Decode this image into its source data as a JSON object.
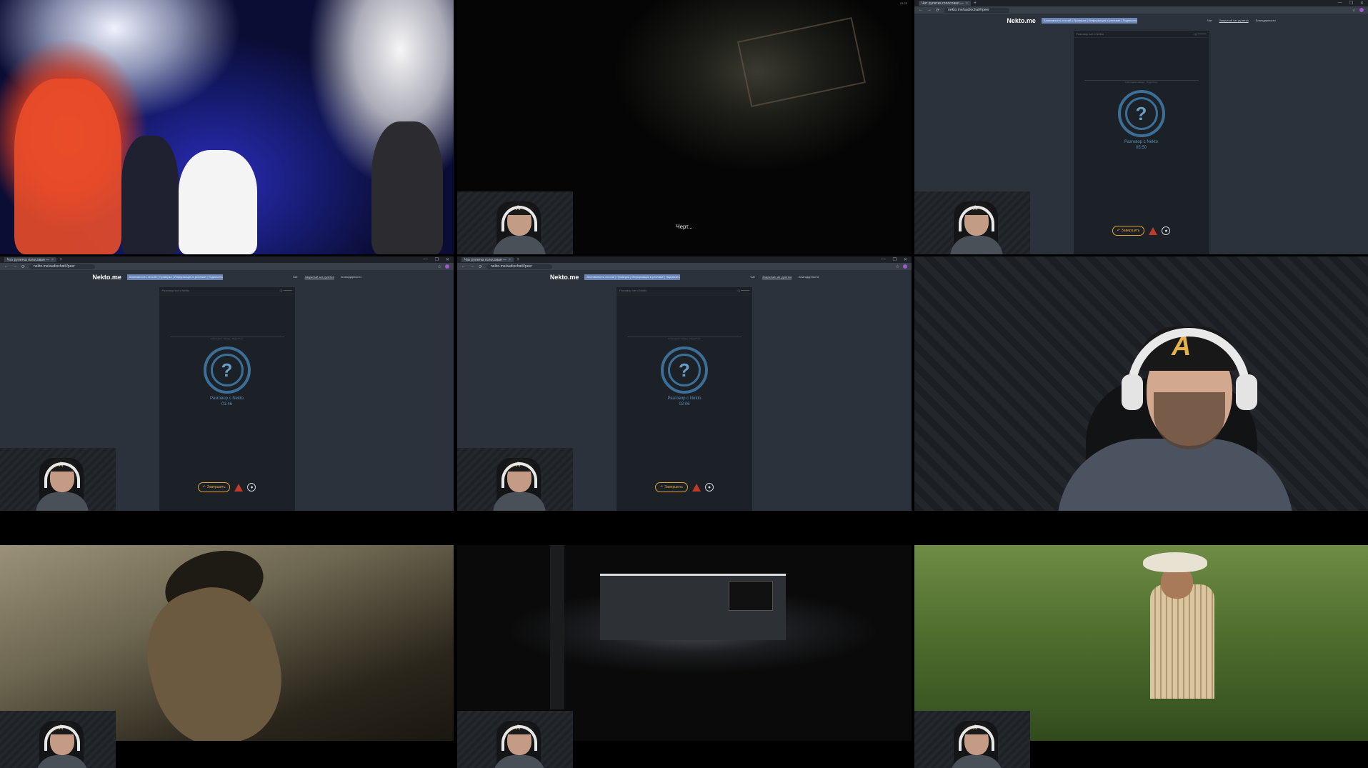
{
  "browser": {
    "tab_title": "Чат рулетка голосовая —",
    "tab_close": "×",
    "new_tab": "+",
    "url": "nekto.me/audiochat#/peer",
    "window_controls": [
      "—",
      "❐",
      "✕"
    ]
  },
  "site": {
    "logo": "Nekto.me",
    "notice": "Анонимность сессий | Проверка | Информация в рекламе | Подписаться",
    "nav": [
      "Чат",
      "Закрытый чат рулетка",
      "Благодарности"
    ],
    "panel_title": "Разговор чат с Nekto",
    "volume_label": "◁) ━━━━━",
    "separator_text": "Собеседник найден · Подробнее",
    "question_mark": "?",
    "conversation_label": "Разговор с Nekto",
    "end_button": "Завершить",
    "end_icon": "↶",
    "mic_icon": "🎙"
  },
  "cells": {
    "top_right": {
      "timer": "05:50"
    },
    "mid_left": {
      "timer": "01:46"
    },
    "mid_center": {
      "timer": "02:06"
    }
  },
  "subtitle": "Черт...",
  "corner_timestamp": "01:25",
  "cap_logo": "A"
}
